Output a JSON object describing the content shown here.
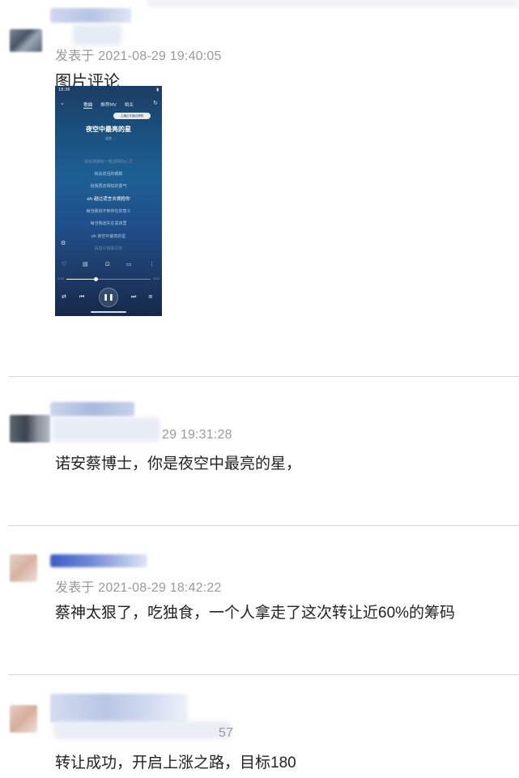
{
  "comments": [
    {
      "meta": "发表于 2021-08-29 19:40:05",
      "text": "图片评论",
      "image": {
        "status_time": "18:36",
        "tabs": [
          "歌曲",
          "推荐MV",
          "相关"
        ],
        "chip": "主播正在播这首歌",
        "song_title": "夜空中最亮的星",
        "artist": "逃跑",
        "lyrics": [
          "我祈祷拥有一颗透明的心灵",
          "和会流泪的眼睛",
          "给我再去相信的勇气",
          "oh 越过谎言去拥抱你",
          "每当我找不到存在的意义",
          "每当我迷失在黑夜里",
          "oh 夜空中最亮的星",
          "请指引我靠近你"
        ],
        "current_time": "1:12",
        "total_time": "4:12"
      }
    },
    {
      "meta": "29 19:31:28",
      "text": "诺安蔡博士，你是夜空中最亮的星，"
    },
    {
      "meta": "发表于 2021-08-29 18:42:22",
      "text": "蔡神太狠了，吃独食，一个人拿走了这次转让近60%的筹码"
    },
    {
      "meta": "57",
      "text": "转让成功，开启上涨之路，目标180"
    }
  ],
  "colors": {
    "meta_gray": "#9a9a9a",
    "divider": "#d8d8d8",
    "username_blue": "#aebde0"
  }
}
